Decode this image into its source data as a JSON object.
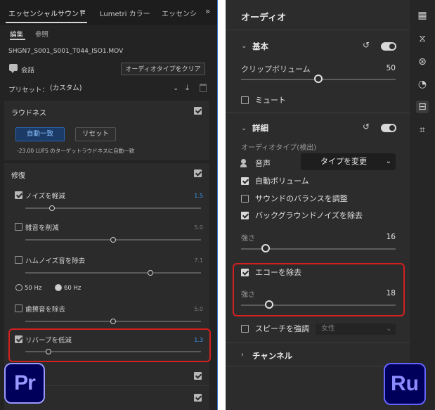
{
  "premiere": {
    "tabs": [
      "エッセンシャルサウンド",
      "Lumetri カラー",
      "エッセンシ"
    ],
    "subtabs": [
      "編集",
      "参照"
    ],
    "file_name": "SHGN7_S001_S001_T044_ISO1.MOV",
    "audio_type": "会話",
    "clear_type_button": "オーディオタイプをクリア",
    "preset_label": "プリセット：",
    "preset_value": "(カスタム)",
    "loudness": {
      "title": "ラウドネス",
      "auto_match_button": "自動一致",
      "reset_button": "リセット",
      "target_text": "-23.00 LUFS のターゲットラウドネスに自動一致"
    },
    "repair": {
      "title": "修復",
      "items": [
        {
          "label": "ノイズを軽減",
          "value": "1.5",
          "checked": true,
          "level": 0.15
        },
        {
          "label": "雑音を削減",
          "value": "5.0",
          "checked": false,
          "level": 0.5
        },
        {
          "label": "ハムノイズ音を除去",
          "value": "7.1",
          "checked": false,
          "level": 0.71
        },
        {
          "label": "歯擦音を除去",
          "value": "5.0",
          "checked": false,
          "level": 0.5
        },
        {
          "label": "リバーブを低減",
          "value": "1.3",
          "checked": true,
          "level": 0.13
        }
      ],
      "hum_options": [
        "50 Hz",
        "60 Hz"
      ],
      "hum_selected": "60 Hz"
    },
    "logo": "Pr"
  },
  "rush": {
    "title": "オーディオ",
    "basic": {
      "title": "基本",
      "clip_volume_label": "クリップボリューム",
      "clip_volume_value": "50",
      "clip_volume_level": 0.5,
      "mute_label": "ミュート"
    },
    "advanced": {
      "title": "詳細",
      "audio_type_label": "オーディオタイプ(検出)",
      "voice_label": "音声",
      "change_type_button": "タイプを変更",
      "auto_volume_label": "自動ボリューム",
      "balance_label": "サウンドのバランスを調整",
      "bg_noise_label": "バックグラウンドノイズを除去",
      "bg_strength_label": "強さ",
      "bg_strength_value": "16",
      "bg_strength_level": 0.16,
      "echo_label": "エコーを除去",
      "echo_strength_label": "強さ",
      "echo_strength_value": "18",
      "echo_strength_level": 0.18,
      "enhance_speech_label": "スピーチを強調",
      "enhance_speech_value": "女性"
    },
    "channels_title": "チャンネル",
    "logo": "Ru"
  }
}
